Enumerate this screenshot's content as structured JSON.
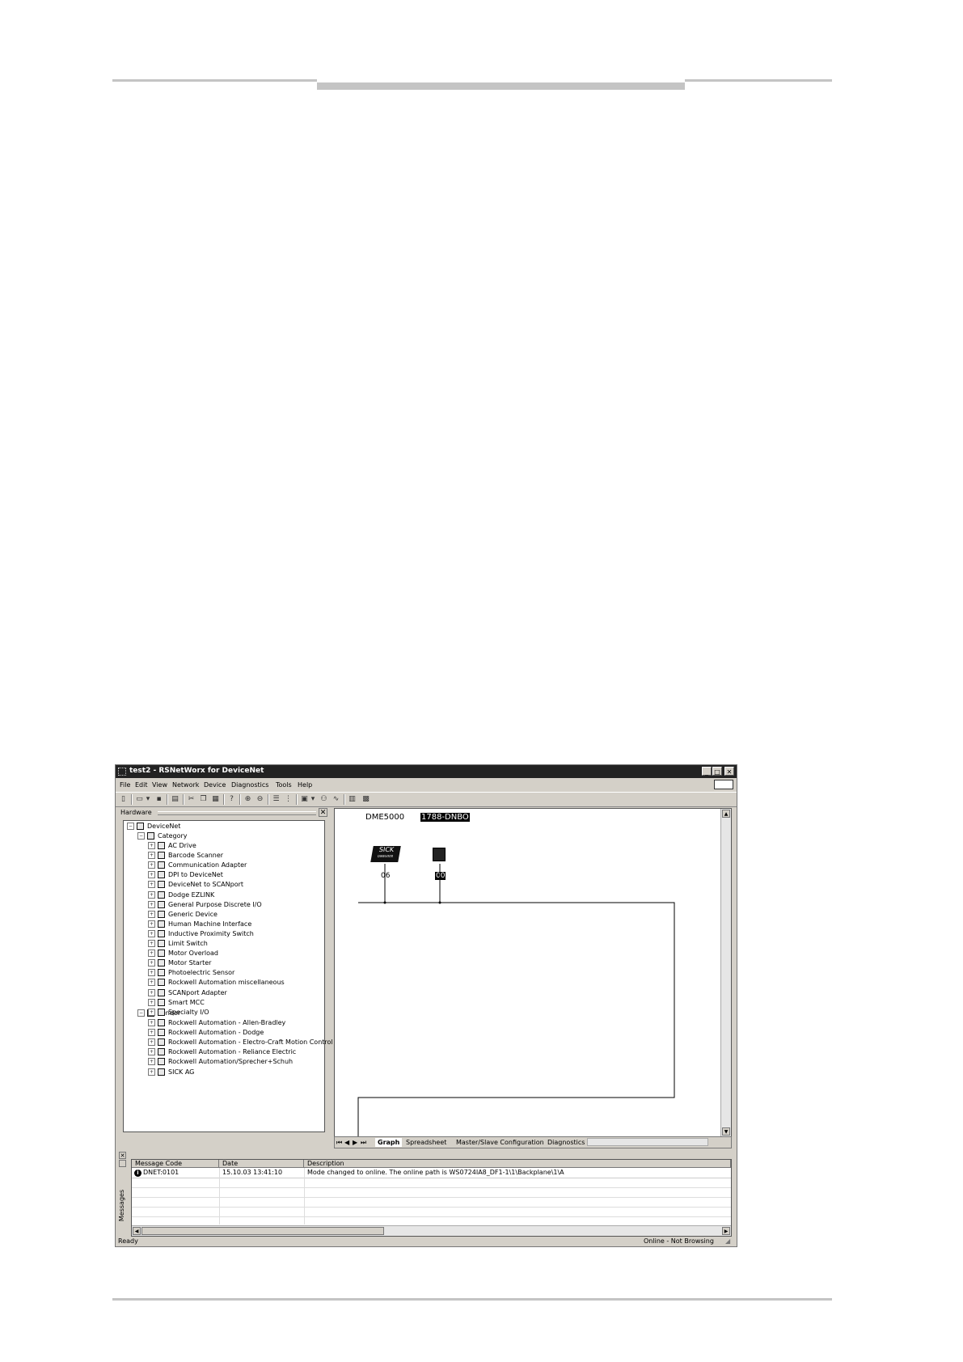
{
  "window": {
    "title": "test2 - RSNetWorx for DeviceNet",
    "controls": [
      "_",
      "□",
      "✕"
    ]
  },
  "menu": [
    "File",
    "Edit",
    "View",
    "Network",
    "Device",
    "Diagnostics",
    "Tools",
    "Help"
  ],
  "hardware_panel": {
    "title": "Hardware",
    "tree": {
      "root": "DeviceNet",
      "category_label": "Category",
      "categories": [
        "AC Drive",
        "Barcode Scanner",
        "Communication Adapter",
        "DPI to DeviceNet",
        "DeviceNet to SCANport",
        "Dodge EZLINK",
        "General Purpose Discrete I/O",
        "Generic Device",
        "Human Machine Interface",
        "Inductive Proximity Switch",
        "Limit Switch",
        "Motor Overload",
        "Motor Starter",
        "Photoelectric Sensor",
        "Rockwell Automation miscellaneous",
        "SCANport Adapter",
        "Smart MCC",
        "Specialty I/O"
      ],
      "vendor_label": "Vendor",
      "vendors": [
        "Rockwell Automation - Allen-Bradley",
        "Rockwell Automation - Dodge",
        "Rockwell Automation - Electro-Craft Motion Control",
        "Rockwell Automation - Reliance Electric",
        "Rockwell Automation/Sprecher+Schuh",
        "SICK AG"
      ]
    }
  },
  "graph": {
    "devices": [
      {
        "name": "DME5000",
        "logo_text": "SICK",
        "logo_subtext": "DME5000",
        "address": "06",
        "selected": false
      },
      {
        "name": "1788-DNBO",
        "address": "00",
        "selected": true
      }
    ]
  },
  "tabs": [
    "Graph",
    "Spreadsheet",
    "Master/Slave Configuration",
    "Diagnostics"
  ],
  "active_tab": "Graph",
  "messages": {
    "side_label": "Messages",
    "columns": [
      "Message Code",
      "Date",
      "Description"
    ],
    "rows": [
      {
        "code": "DNET:0101",
        "date": "15.10.03 13:41:10",
        "description": "Mode changed to online.  The online path is WS0724IA8_DF1-1\\1\\Backplane\\1\\A"
      }
    ]
  },
  "status": {
    "left": "Ready",
    "right": "Online - Not Browsing"
  }
}
